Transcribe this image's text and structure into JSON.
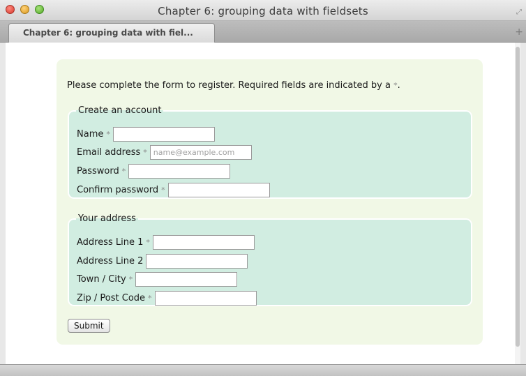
{
  "window": {
    "title": "Chapter 6: grouping data with fieldsets"
  },
  "tabs": [
    {
      "label": "Chapter 6: grouping data with fiel..."
    }
  ],
  "form": {
    "intro_text": "Please complete the form to register. Required fields are indicated by a",
    "required_marker": "*",
    "intro_end": ".",
    "fieldsets": [
      {
        "legend": "Create an account",
        "fields": [
          {
            "label": "Name",
            "required": true,
            "value": "",
            "placeholder": ""
          },
          {
            "label": "Email address",
            "required": true,
            "value": "",
            "placeholder": "name@example.com"
          },
          {
            "label": "Password",
            "required": true,
            "value": "",
            "placeholder": ""
          },
          {
            "label": "Confirm password",
            "required": true,
            "value": "",
            "placeholder": ""
          }
        ]
      },
      {
        "legend": "Your address",
        "fields": [
          {
            "label": "Address Line 1",
            "required": true,
            "value": "",
            "placeholder": ""
          },
          {
            "label": "Address Line 2",
            "required": false,
            "value": "",
            "placeholder": ""
          },
          {
            "label": "Town / City",
            "required": true,
            "value": "",
            "placeholder": ""
          },
          {
            "label": "Zip / Post Code",
            "required": true,
            "value": "",
            "placeholder": ""
          }
        ]
      }
    ],
    "submit_label": "Submit"
  },
  "colors": {
    "panel_background": "#f1f8e6",
    "fieldset_background": "#d1ede1",
    "required_marker": "#888888"
  },
  "icons": [
    "window-close-icon",
    "window-minimize-icon",
    "window-zoom-icon",
    "fullscreen-icon",
    "new-tab-icon"
  ]
}
